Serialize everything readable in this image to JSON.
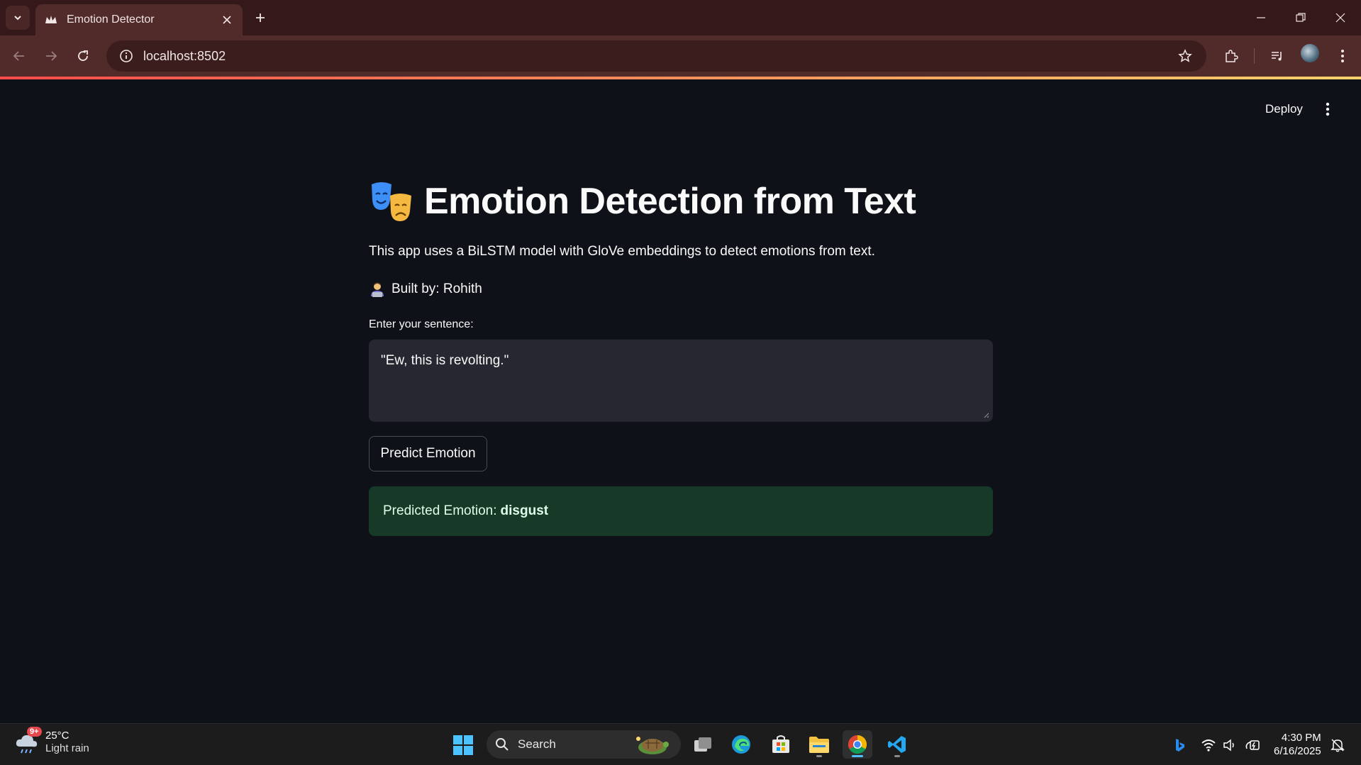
{
  "browser": {
    "tab_title": "Emotion Detector",
    "url": "localhost:8502"
  },
  "app": {
    "header": {
      "deploy_label": "Deploy"
    },
    "title": "Emotion Detection from Text",
    "description": "This app uses a BiLSTM model with GloVe embeddings to detect emotions from text.",
    "built_by": "Built by: Rohith",
    "input": {
      "label": "Enter your sentence:",
      "value": "\"Ew, this is revolting.\""
    },
    "predict_button": "Predict Emotion",
    "result": {
      "prefix": "Predicted Emotion:",
      "emotion": "disgust"
    }
  },
  "taskbar": {
    "weather": {
      "badge": "9+",
      "temp": "25°C",
      "condition": "Light rain"
    },
    "search_label": "Search",
    "time": "4:30 PM",
    "date": "6/16/2025"
  },
  "colors": {
    "app_bg": "#0e1117",
    "input_bg": "#262730",
    "success_bg": "#173928",
    "chrome_tabbar": "#35191a",
    "chrome_toolbar": "#512a2a"
  }
}
